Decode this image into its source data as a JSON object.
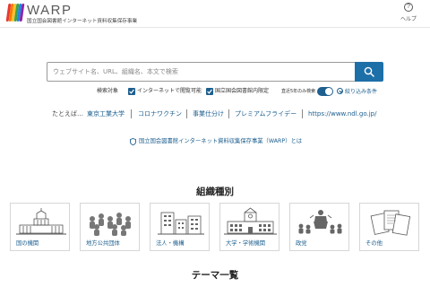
{
  "header": {
    "brand": "WARP",
    "tagline": "国立国会図書館インターネット資料収集保存事業",
    "help_label": "ヘルプ",
    "logo_colors": [
      "#e53935",
      "#f57c00",
      "#fbc02d",
      "#43a047",
      "#1e88e5",
      "#8e24aa"
    ]
  },
  "search": {
    "placeholder": "ウェブサイト名、URL、組織名、本文で検索",
    "button_icon": "search-icon",
    "accent": "#1d6fa8"
  },
  "options": {
    "target_label": "検索対象",
    "web_accessible_label": "インターネットで閲覧可能",
    "in_library_label": "国立国会図書館内限定",
    "recent_label": "直近5年のみ検索",
    "refine_label": "絞り込み条件",
    "web_accessible_checked": true,
    "in_library_checked": true,
    "recent_on": true
  },
  "suggestions": {
    "lead": "たとえば…",
    "links": [
      "東京工業大学",
      "コロナワクチン",
      "事業仕分け",
      "プレミアムフライデー",
      "https://www.ndl.go.jp/"
    ]
  },
  "about_link": "国立国会図書館インターネット資料収集保存事業（WARP）とは",
  "org_section": {
    "title": "組織種別",
    "cards": [
      {
        "label": "国の機関",
        "icon": "diet-building-icon"
      },
      {
        "label": "地方公共団体",
        "icon": "crowd-icon"
      },
      {
        "label": "法人・機構",
        "icon": "office-buildings-icon"
      },
      {
        "label": "大学・学術機関",
        "icon": "university-icon"
      },
      {
        "label": "政党",
        "icon": "speech-podium-icon"
      },
      {
        "label": "その他",
        "icon": "documents-icon"
      }
    ]
  },
  "theme_section": {
    "title": "テーマ一覧"
  }
}
